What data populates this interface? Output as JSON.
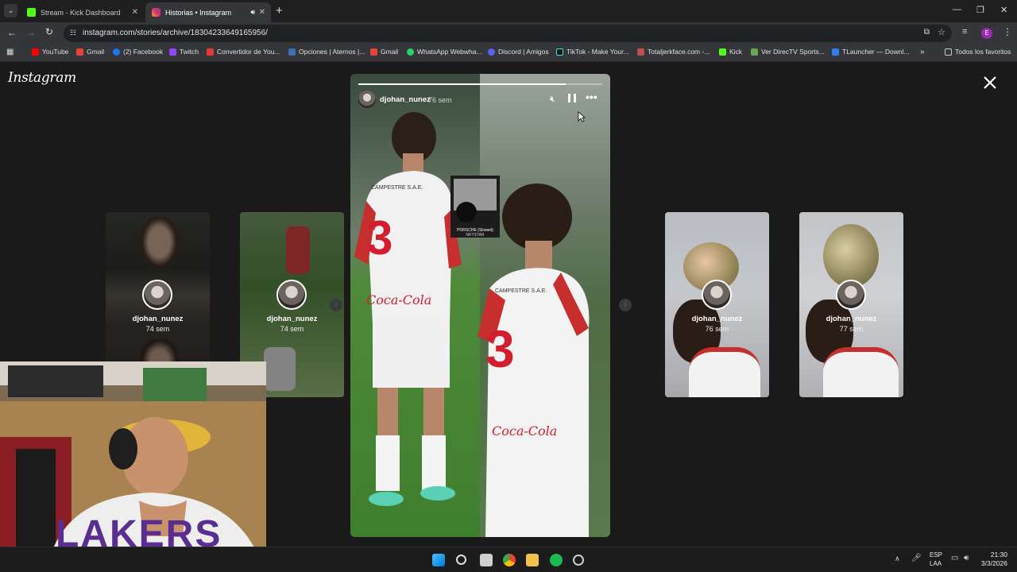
{
  "browser": {
    "tabs": [
      {
        "title": "Stream - Kick Dashboard",
        "favicon": "kick-icon",
        "active": false
      },
      {
        "title": "Historias • Instagram",
        "favicon": "instagram-icon",
        "active": true
      }
    ],
    "url": "instagram.com/stories/archive/18304233649165956/",
    "bookmarks": [
      {
        "label": "YouTube",
        "color": "#ff0000"
      },
      {
        "label": "Gmail",
        "color": "#ea4335"
      },
      {
        "label": "(2) Facebook",
        "color": "#1877f2"
      },
      {
        "label": "Twitch",
        "color": "#9146ff"
      },
      {
        "label": "Convertidor de You...",
        "color": "#e53935"
      },
      {
        "label": "Opciones | Aternos |...",
        "color": "#3b6fb6"
      },
      {
        "label": "Gmail",
        "color": "#ea4335"
      },
      {
        "label": "WhatsApp Webwha...",
        "color": "#25d366"
      },
      {
        "label": "Discord | Amigos",
        "color": "#5865f2"
      },
      {
        "label": "TikTok - Make Your...",
        "color": "#111111"
      },
      {
        "label": "Totaljerkface.com -...",
        "color": "#c0504d"
      },
      {
        "label": "Kick",
        "color": "#53fc18"
      },
      {
        "label": "Ver DirecTV Sports...",
        "color": "#6aa84f"
      },
      {
        "label": "TLauncher — Downl...",
        "color": "#2f80ed"
      }
    ],
    "all_bookmarks_label": "Todos los favoritos",
    "profile_initial": "E"
  },
  "instagram": {
    "logo": "Instagram",
    "story": {
      "username": "djohan_nunez",
      "time": "76 sem",
      "progress": 0.85,
      "music_line1": "PORSCHE (Slowed)",
      "music_line2": "NKYSTAR"
    },
    "previews": [
      {
        "username": "djohan_nunez",
        "time": "74 sem"
      },
      {
        "username": "djohan_nunez",
        "time": "74 sem"
      },
      {
        "username": "djohan_nunez",
        "time": "76 sem"
      },
      {
        "username": "djohan_nunez",
        "time": "77 sem"
      }
    ],
    "jersey_text": {
      "number": "3",
      "sponsor": "Coca-Cola",
      "club": "CAMPESTRE S.A.E."
    }
  },
  "webcam": {
    "shirt_text": "LAKERS"
  },
  "taskbar": {
    "lang_line1": "ESP",
    "lang_line2": "LAA",
    "time": "21:30",
    "date": "3/3/2026"
  }
}
